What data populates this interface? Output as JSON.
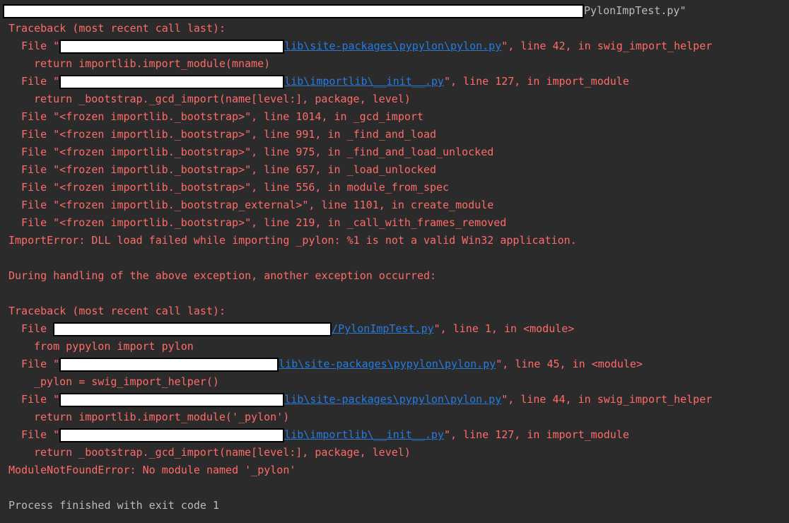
{
  "header": {
    "script_path_tail": "PylonImpTest.py\""
  },
  "traceback1": {
    "title": "Traceback (most recent call last):",
    "frames": [
      {
        "prefix": "File \"",
        "link": "lib\\site-packages\\pypylon\\pylon.py",
        "suffix": "\", line 42, in swig_import_helper",
        "code": "return importlib.import_module(mname)"
      },
      {
        "prefix": "File \"",
        "link": "lib\\importlib\\__init__.py",
        "suffix": "\", line 127, in import_module",
        "code": "return _bootstrap._gcd_import(name[level:], package, level)"
      }
    ],
    "frozen": [
      "File \"<frozen importlib._bootstrap>\", line 1014, in _gcd_import",
      "File \"<frozen importlib._bootstrap>\", line 991, in _find_and_load",
      "File \"<frozen importlib._bootstrap>\", line 975, in _find_and_load_unlocked",
      "File \"<frozen importlib._bootstrap>\", line 657, in _load_unlocked",
      "File \"<frozen importlib._bootstrap>\", line 556, in module_from_spec",
      "File \"<frozen importlib._bootstrap_external>\", line 1101, in create_module",
      "File \"<frozen importlib._bootstrap>\", line 219, in _call_with_frames_removed"
    ],
    "error": "ImportError: DLL load failed while importing _pylon: %1 is not a valid Win32 application."
  },
  "separator": "During handling of the above exception, another exception occurred:",
  "traceback2": {
    "title": "Traceback (most recent call last):",
    "frames": [
      {
        "prefix": "File ",
        "link": "/PylonImpTest.py",
        "suffix": "\", line 1, in <module>",
        "code": "from pypylon import pylon"
      },
      {
        "prefix": "File \"",
        "link": "lib\\site-packages\\pypylon\\pylon.py",
        "suffix": "\", line 45, in <module>",
        "code": "_pylon = swig_import_helper()"
      },
      {
        "prefix": "File \"",
        "link": "lib\\site-packages\\pypylon\\pylon.py",
        "suffix": "\", line 44, in swig_import_helper",
        "code": "return importlib.import_module('_pylon')"
      },
      {
        "prefix": "File \"",
        "link": "lib\\importlib\\__init__.py",
        "suffix": "\", line 127, in import_module",
        "code": "return _bootstrap._gcd_import(name[level:], package, level)"
      }
    ],
    "error": "ModuleNotFoundError: No module named '_pylon'"
  },
  "footer": "Process finished with exit code 1",
  "colors": {
    "background": "#2b2b2b",
    "error_text": "#ff6b68",
    "plain_text": "#bbbbbb",
    "link": "#287bde",
    "redaction": "#ffffff"
  }
}
